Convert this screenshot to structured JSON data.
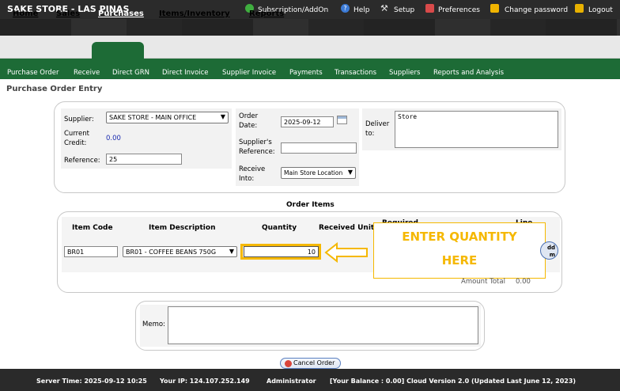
{
  "app": {
    "title": "SAKE STORE - LAS PINAS"
  },
  "top_links": [
    {
      "label": "Subscription/AddOn",
      "icon": "globe-icon"
    },
    {
      "label": "Help",
      "icon": "help-icon"
    },
    {
      "label": "Setup",
      "icon": "tools-icon"
    },
    {
      "label": "Preferences",
      "icon": "preferences-icon"
    },
    {
      "label": "Change password",
      "icon": "lock-icon"
    },
    {
      "label": "Logout",
      "icon": "key-icon"
    }
  ],
  "main_tabs": [
    "Home",
    "Sales",
    "Purchases",
    "Items/Inventory",
    "Reports"
  ],
  "active_tab": "Purchases",
  "sub_nav": [
    "Purchase Order",
    "Receive",
    "Direct GRN",
    "Direct Invoice",
    "Supplier Invoice",
    "Payments",
    "Transactions",
    "Suppliers",
    "Reports and Analysis"
  ],
  "page_title": "Purchase Order Entry",
  "header_form": {
    "supplier_label": "Supplier:",
    "supplier_value": "SAKE STORE - MAIN OFFICE",
    "current_credit_label": "Current Credit:",
    "current_credit_value": "0.00",
    "reference_label": "Reference:",
    "reference_value": "25",
    "order_date_label": "Order Date:",
    "order_date_value": "2025-09-12",
    "supplier_ref_label": "Supplier's Reference:",
    "supplier_ref_value": "",
    "receive_into_label": "Receive Into:",
    "receive_into_value": "Main Store Location",
    "deliver_to_label": "Deliver to:",
    "deliver_to_value": "Store"
  },
  "order_items": {
    "section_title": "Order Items",
    "columns": [
      "Item Code",
      "Item Description",
      "Quantity",
      "Received Unit",
      "Required",
      "Line"
    ],
    "row": {
      "item_code": "BR01",
      "item_description": "BR01 - COFFEE BEANS 750G",
      "quantity": "10"
    },
    "add_button": "dd m",
    "amount_total_label": "Amount Total",
    "amount_total_value": "0.00"
  },
  "callout": {
    "line1": "ENTER QUANTITY",
    "line2": "HERE",
    "color": "#f5b800"
  },
  "memo": {
    "label": "Memo:",
    "value": ""
  },
  "cancel_button": "Cancel Order",
  "footer": {
    "server_time": "Server Time: 2025-09-12 10:25",
    "ip": "Your IP: 124.107.252.149",
    "user": "Administrator",
    "balance": "[Your Balance : 0.00] Cloud Version 2.0 (Updated Last June 12, 2023)"
  },
  "colors": {
    "nav_green": "#1d6b36",
    "top_bar": "#2b2b2b",
    "highlight": "#f5b800"
  }
}
